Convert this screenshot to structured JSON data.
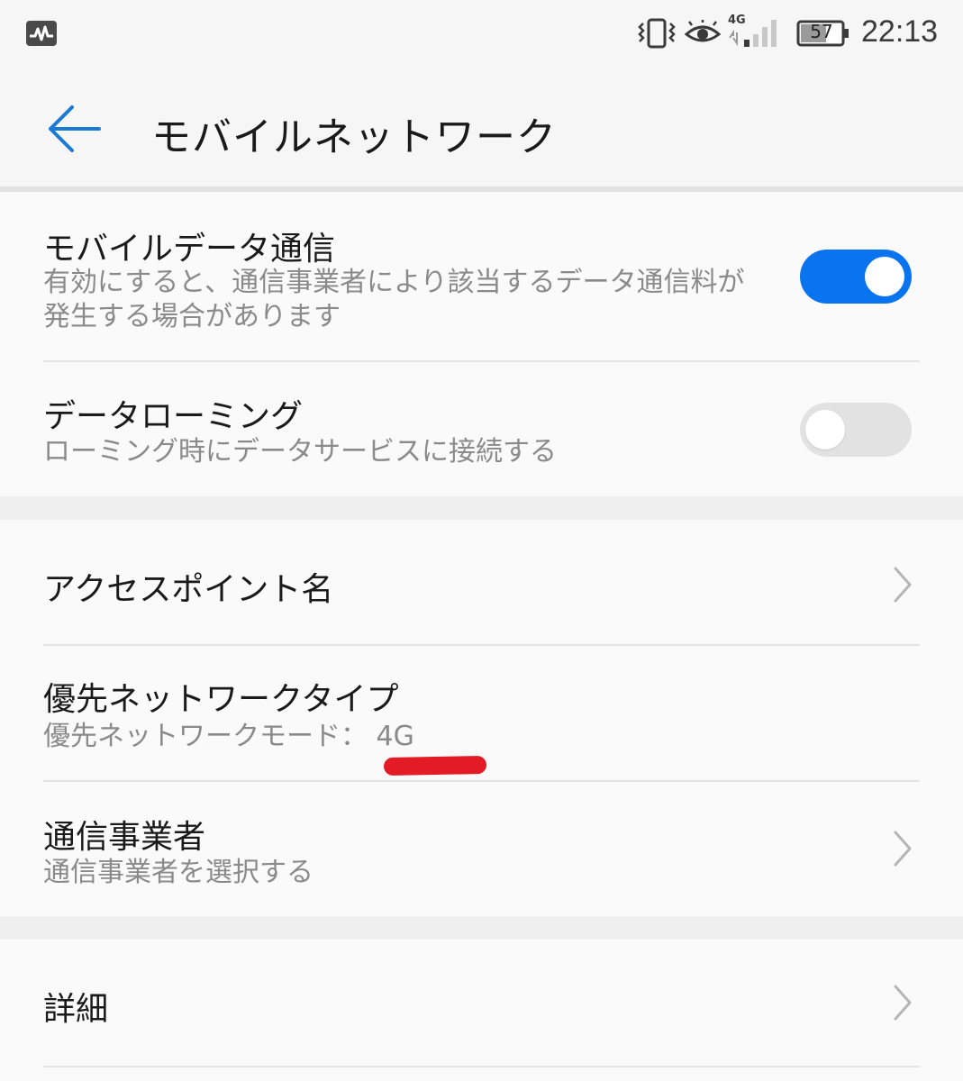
{
  "status_bar": {
    "left_icon": "activity-monitor-icon",
    "network_type": "4G",
    "battery_level": "57",
    "time": "22:13",
    "icons": [
      "vibrate-icon",
      "eye-comfort-icon",
      "signal-icon",
      "battery-icon"
    ]
  },
  "app_bar": {
    "back_icon": "arrow-left-icon",
    "title": "モバイルネットワーク",
    "accent_color": "#1a7ad4"
  },
  "settings": {
    "mobile_data": {
      "title": "モバイルデータ通信",
      "subtitle": "有効にすると、通信事業者により該当するデータ通信料が発生する場合があります",
      "enabled": true
    },
    "data_roaming": {
      "title": "データローミング",
      "subtitle": "ローミング時にデータサービスに接続する",
      "enabled": false
    },
    "apn": {
      "title": "アクセスポイント名"
    },
    "preferred_network": {
      "title": "優先ネットワークタイプ",
      "subtitle": "優先ネットワークモード： 4G"
    },
    "carrier": {
      "title": "通信事業者",
      "subtitle": "通信事業者を選択する"
    },
    "details": {
      "title": "詳細"
    }
  },
  "colors": {
    "toggle_on": "#0a74f0",
    "toggle_off": "#e2e2e2",
    "highlight_mark": "#e21b24"
  }
}
